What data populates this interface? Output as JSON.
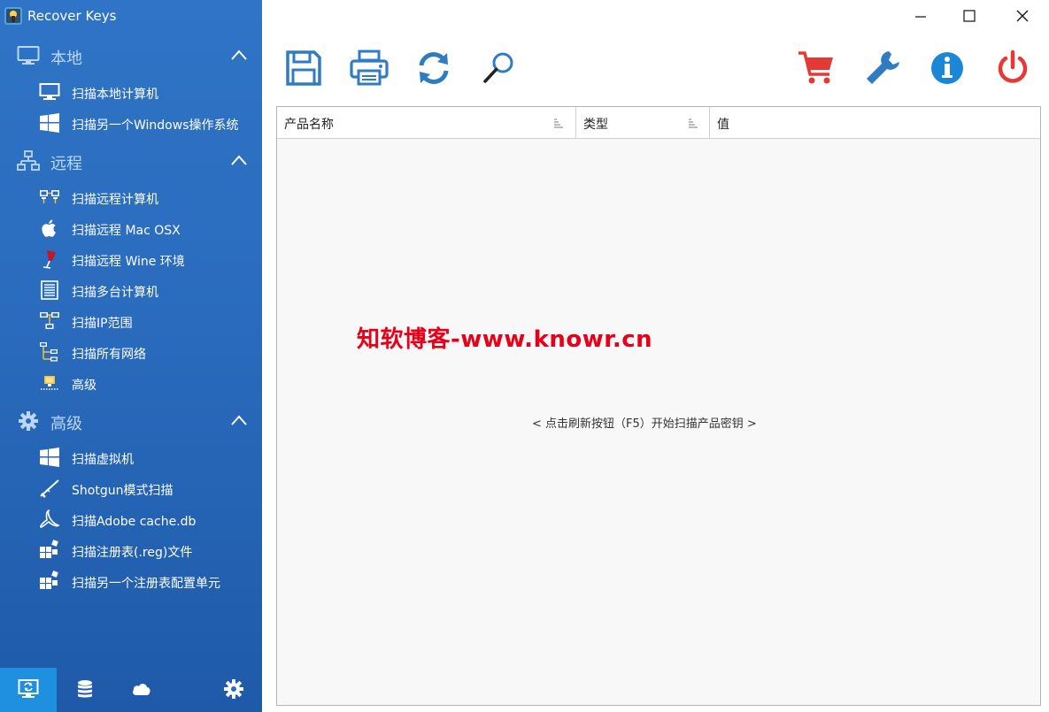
{
  "app": {
    "title": "Recover Keys"
  },
  "sidebar": {
    "sections": [
      {
        "label": "本地",
        "icon": "monitor-icon",
        "items": [
          {
            "label": "扫描本地计算机",
            "icon": "monitor-icon"
          },
          {
            "label": "扫描另一个Windows操作系统",
            "icon": "windows-icon"
          }
        ]
      },
      {
        "label": "远程",
        "icon": "network-icon",
        "items": [
          {
            "label": "扫描远程计算机",
            "icon": "remote-computers-icon"
          },
          {
            "label": "扫描远程 Mac OSX",
            "icon": "apple-icon"
          },
          {
            "label": "扫描远程 Wine 环境",
            "icon": "wine-glass-icon"
          },
          {
            "label": "扫描多台计算机",
            "icon": "list-document-icon"
          },
          {
            "label": "扫描IP范围",
            "icon": "ip-range-icon"
          },
          {
            "label": "扫描所有网络",
            "icon": "all-networks-icon"
          },
          {
            "label": "高级",
            "icon": "advanced-network-icon"
          }
        ]
      },
      {
        "label": "高级",
        "icon": "gear-icon",
        "items": [
          {
            "label": "扫描虚拟机",
            "icon": "windows-icon"
          },
          {
            "label": "Shotgun模式扫描",
            "icon": "shotgun-icon"
          },
          {
            "label": "扫描Adobe cache.db",
            "icon": "adobe-acrobat-icon"
          },
          {
            "label": "扫描注册表(.reg)文件",
            "icon": "registry-icon"
          },
          {
            "label": "扫描另一个注册表配置单元",
            "icon": "registry-icon"
          }
        ]
      }
    ],
    "bottom_tabs": [
      {
        "icon": "local-computer-icon",
        "active": true
      },
      {
        "icon": "database-icon",
        "active": false
      },
      {
        "icon": "cloud-icon",
        "active": false
      },
      {
        "icon": "gear-icon",
        "active": false
      }
    ]
  },
  "toolbar": {
    "left_buttons": [
      "save-icon",
      "print-icon",
      "refresh-icon",
      "search-icon"
    ],
    "right_buttons": [
      "cart-icon",
      "wrench-icon",
      "info-icon",
      "power-icon"
    ]
  },
  "table": {
    "columns": [
      "产品名称",
      "类型",
      "值"
    ]
  },
  "watermark": "知软博客-www.knowr.cn",
  "hint": "< 点击刷新按钮（F5）开始扫描产品密钥 >",
  "colors": {
    "sidebar": "#2a6bbd",
    "sidebar_active_tab": "#1f8fe0",
    "toolbar_blue": "#2f7cc4",
    "cart_red": "#e53935",
    "info_blue": "#1a88d6",
    "power_red": "#e53935",
    "watermark_red": "#e6001a"
  }
}
